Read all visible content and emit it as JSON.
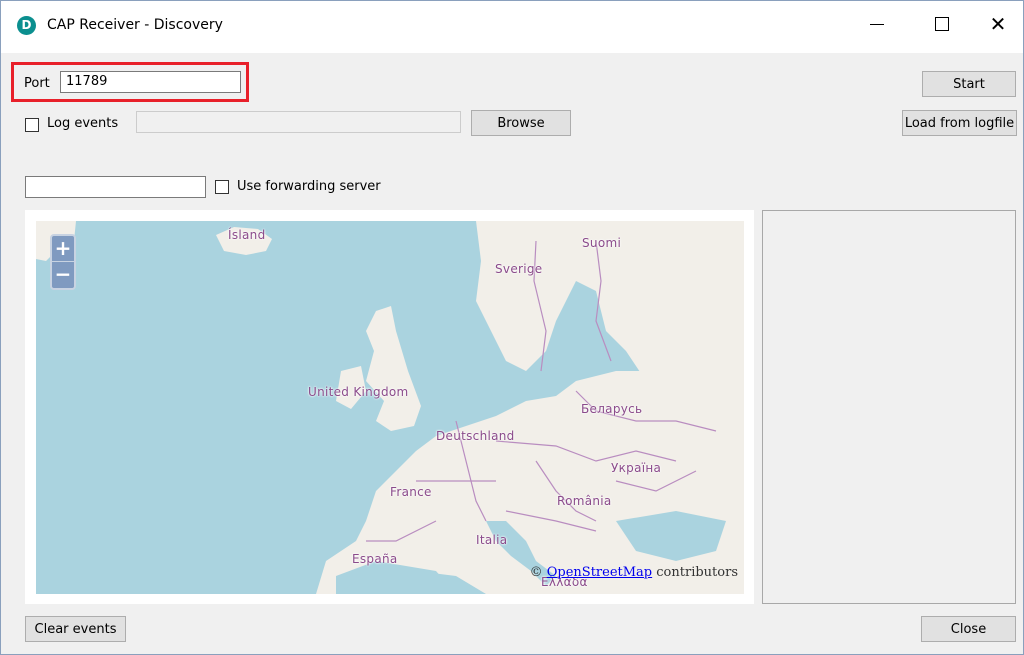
{
  "window": {
    "title": "CAP Receiver - Discovery",
    "app_icon_letter": "D"
  },
  "controls": {
    "port_label": "Port",
    "port_value": "11789",
    "log_events_label": "Log events",
    "log_path_value": "",
    "browse_label": "Browse",
    "start_label": "Start",
    "load_from_logfile_label": "Load from logfile",
    "forwarding_value": "",
    "use_forwarding_label": "Use forwarding server",
    "clear_events_label": "Clear events",
    "close_label": "Close"
  },
  "map": {
    "zoom_in": "+",
    "zoom_out": "−",
    "labels": {
      "island": "Ísland",
      "suomi": "Suomi",
      "sverige": "Sverige",
      "uk": "United Kingdom",
      "belarus": "Беларусь",
      "deutschland": "Deutschland",
      "ukraina": "Україна",
      "france": "France",
      "romania": "România",
      "italia": "Italia",
      "espana": "España",
      "ellada": "Ελλάδα"
    },
    "attribution_prefix": "©",
    "attribution_link": "OpenStreetMap",
    "attribution_suffix": "contributors",
    "colors": {
      "sea": "#aad3df",
      "land": "#f2efe9",
      "border": "#b98dc0",
      "label": "#8b4b8b"
    }
  },
  "highlight_color": "#e8202a"
}
